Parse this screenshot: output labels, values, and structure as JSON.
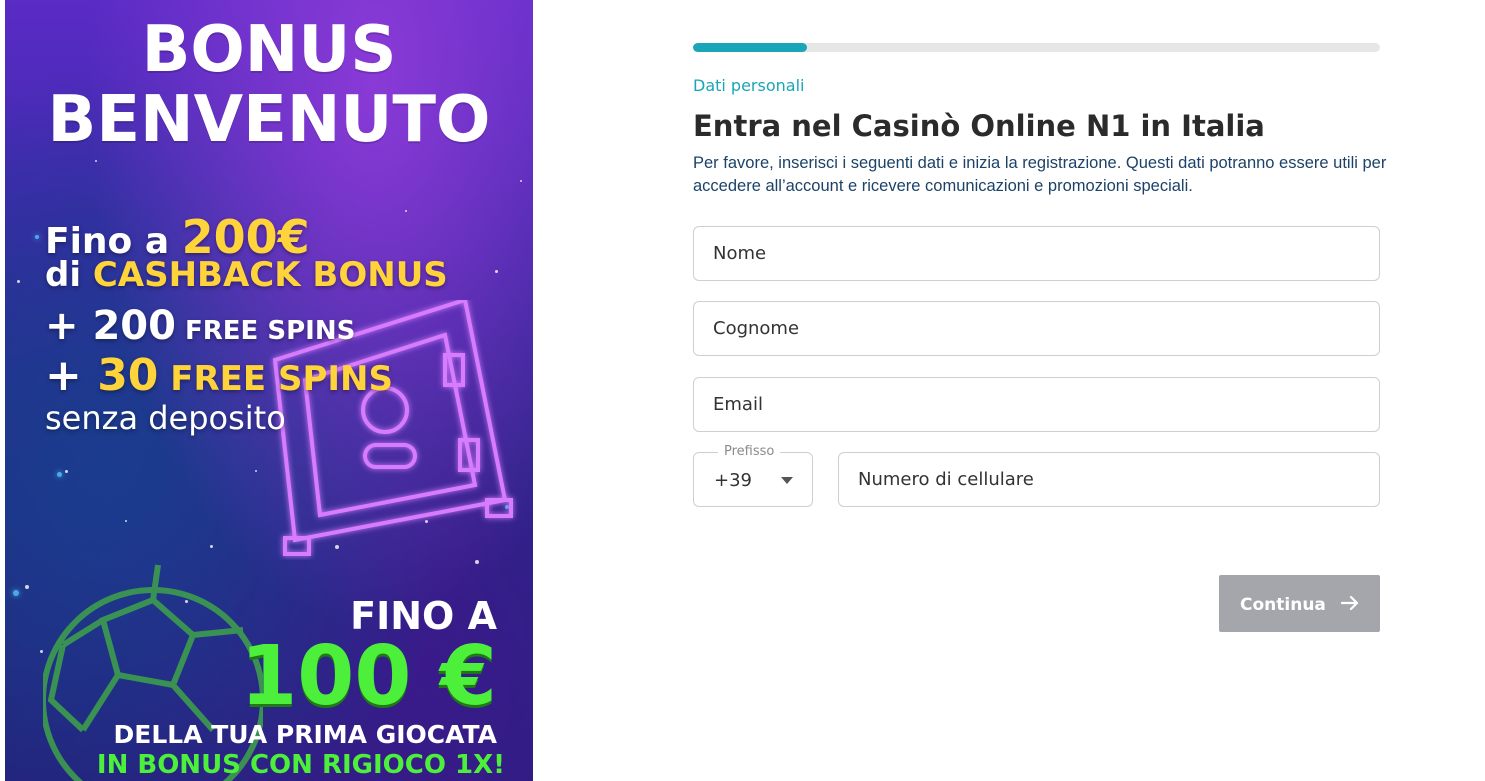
{
  "banner": {
    "title_line1": "BONUS",
    "title_line2": "BENVENUTO",
    "line1_prefix": "Fino a ",
    "line1_amount": "200€",
    "line2_prefix": "di ",
    "line2_highlight": "CASHBACK BONUS",
    "line3_plus": "+ ",
    "line3_number": "200",
    "line3_text": " FREE SPINS",
    "line4_plus": "+ ",
    "line4_number": "30",
    "line4_text": " FREE SPINS",
    "line5": "senza deposito",
    "fino_a": "FINO A",
    "amount_100": "100 €",
    "della": "DELLA TUA PRIMA GIOCATA",
    "rigioco": "IN BONUS CON RIGIOCO 1X!",
    "colors": {
      "yellow": "#ffd43b",
      "green": "#4cf03a",
      "purple": "#5a2bc6"
    }
  },
  "form": {
    "progress": 0.166,
    "step_label": "Dati personali",
    "heading": "Entra nel Casinò Online N1 in Italia",
    "description": "Per favore, inserisci i seguenti dati e inizia la registrazione. Questi dati potranno essere utili per accedere all’account e ricevere comunicazioni e promozioni speciali.",
    "nome_placeholder": "Nome",
    "cognome_placeholder": "Cognome",
    "email_placeholder": "Email",
    "prefix_label": "Prefisso",
    "prefix_value": "+39",
    "phone_placeholder": "Numero di cellulare",
    "continue_label": "Continua",
    "colors": {
      "accent": "#1aa5b8",
      "button_disabled": "#a5a5ac"
    }
  }
}
